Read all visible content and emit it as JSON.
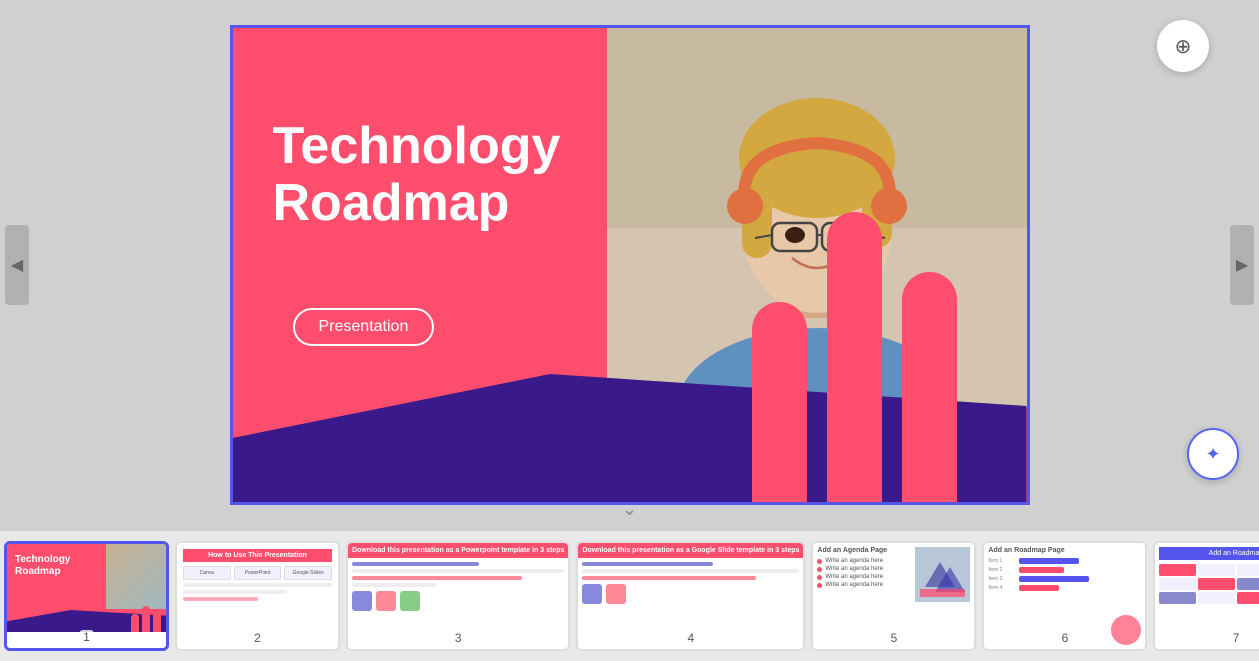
{
  "app": {
    "title": "Technology Roadmap Presentation"
  },
  "main_slide": {
    "title": "Technology\nRoadmap",
    "subtitle_btn": "Presentation",
    "ai_icon": "⊕",
    "magic_icon": "✦"
  },
  "thumbnails": [
    {
      "id": 1,
      "label": "1",
      "title": "Technology\nRoadmap",
      "active": true
    },
    {
      "id": 2,
      "label": "2",
      "title": "How to Use This Presentation"
    },
    {
      "id": 3,
      "label": "3",
      "title": "Download this presentation as a Powerpoint template in 3 steps"
    },
    {
      "id": 4,
      "label": "4",
      "title": "Download this presentation as a Google Slide template in 3 steps"
    },
    {
      "id": 5,
      "label": "5",
      "title": "Add an Agenda Page",
      "items": [
        "Write an agenda here",
        "Write an agenda here",
        "Write an agenda here",
        "Write an agenda here"
      ]
    },
    {
      "id": 6,
      "label": "6",
      "title": "Add an Roadmap Page"
    },
    {
      "id": 7,
      "label": "7",
      "title": "Add an Roadmap"
    }
  ],
  "nav": {
    "left_arrow": "◀",
    "right_arrow": "▶",
    "down_chevron": "⌄"
  }
}
